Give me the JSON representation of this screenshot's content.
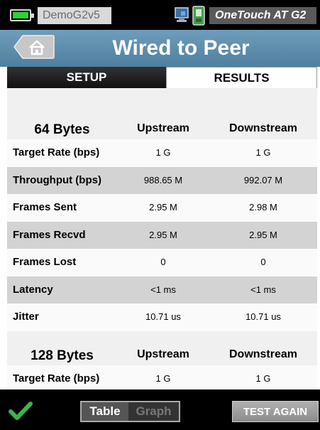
{
  "status_bar": {
    "device_name": "DemoG2v5",
    "model_name": "OneTouch AT G2",
    "battery_icon": "battery-full-icon",
    "network_icon": "network-status-icon"
  },
  "title_bar": {
    "home_icon": "home-icon",
    "title": "Wired to Peer"
  },
  "tabs": [
    {
      "label": "SETUP",
      "active": false
    },
    {
      "label": "RESULTS",
      "active": true
    }
  ],
  "sections": [
    {
      "size_label": "64 Bytes",
      "col_upstream": "Upstream",
      "col_downstream": "Downstream",
      "rows": [
        {
          "label": "Target Rate (bps)",
          "upstream": "1 G",
          "downstream": "1 G"
        },
        {
          "label": "Throughput (bps)",
          "upstream": "988.65 M",
          "downstream": "992.07 M"
        },
        {
          "label": "Frames Sent",
          "upstream": "2.95 M",
          "downstream": "2.98 M"
        },
        {
          "label": "Frames Recvd",
          "upstream": "2.95 M",
          "downstream": "2.95 M"
        },
        {
          "label": "Frames Lost",
          "upstream": "0",
          "downstream": "0"
        },
        {
          "label": "Latency",
          "upstream": "<1 ms",
          "downstream": "<1 ms"
        },
        {
          "label": "Jitter",
          "upstream": "10.71 us",
          "downstream": "10.71 us"
        }
      ]
    },
    {
      "size_label": "128 Bytes",
      "col_upstream": "Upstream",
      "col_downstream": "Downstream",
      "rows": [
        {
          "label": "Target Rate (bps)",
          "upstream": "1 G",
          "downstream": "1 G"
        }
      ]
    }
  ],
  "bottom_bar": {
    "status_icon": "checkmark-icon",
    "table_label": "Table",
    "graph_label": "Graph",
    "test_again_label": "TEST AGAIN"
  },
  "colors": {
    "title_bar": "#5f8fae",
    "battery": "#2fd12f",
    "check": "#3bb54a",
    "row_dark": "#d3d3d3",
    "row_light": "#fafafa"
  }
}
